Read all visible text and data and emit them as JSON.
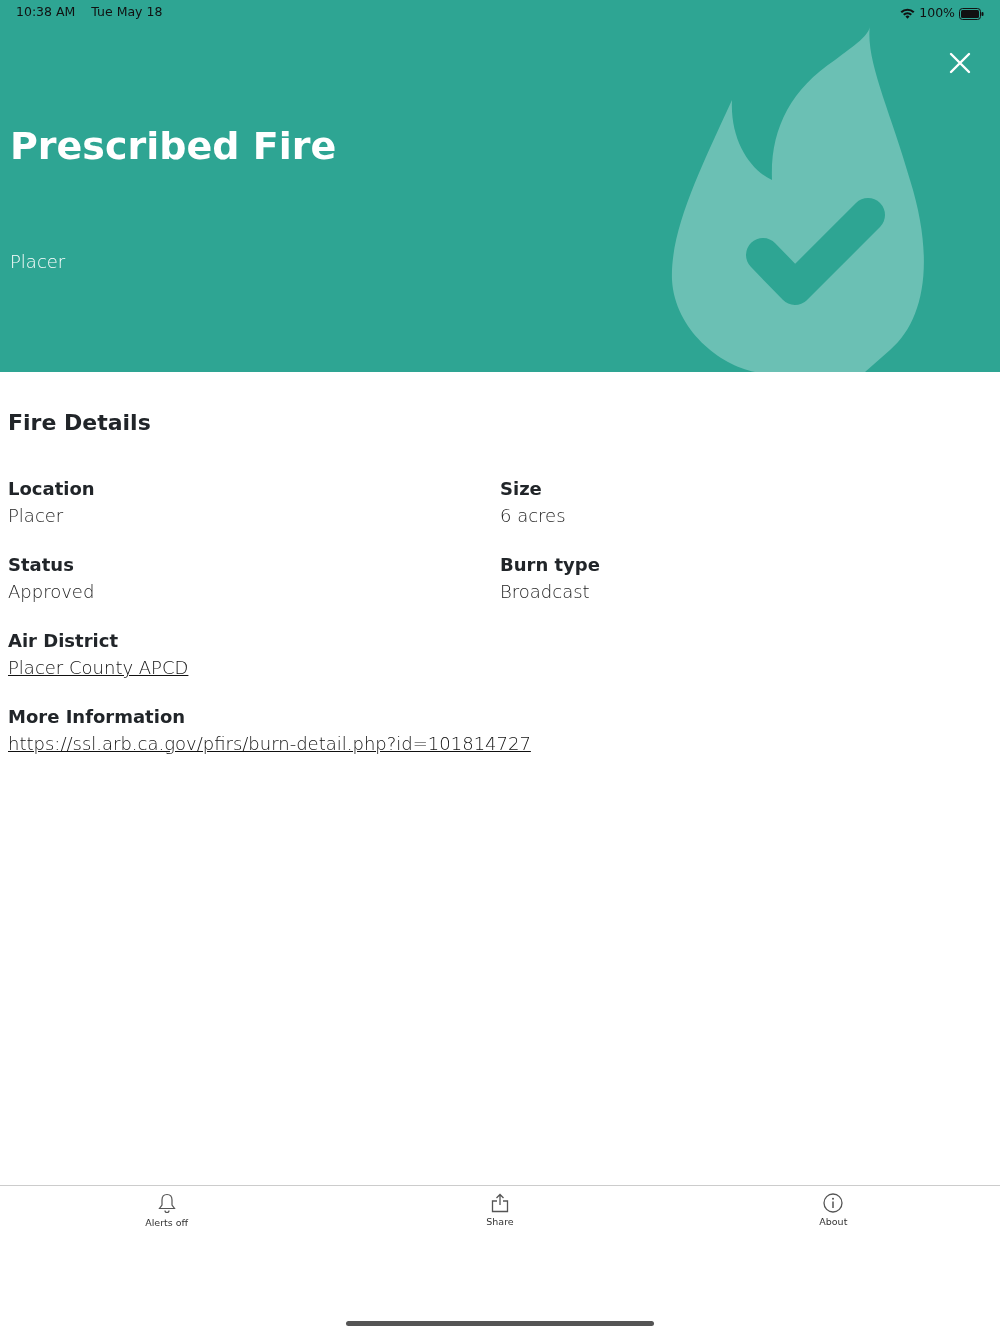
{
  "status_bar": {
    "time": "10:38 AM",
    "date": "Tue May 18",
    "battery": "100%"
  },
  "header": {
    "title": "Prescribed Fire",
    "subtitle": "Placer"
  },
  "section_title": "Fire Details",
  "fields": [
    {
      "label": "Location",
      "value": "Placer",
      "kind": "text"
    },
    {
      "label": "Size",
      "value": "6 acres",
      "kind": "text"
    },
    {
      "label": "Status",
      "value": "Approved",
      "kind": "text"
    },
    {
      "label": "Burn type",
      "value": "Broadcast",
      "kind": "text"
    },
    {
      "label": "Air District",
      "value": "Placer County APCD",
      "kind": "link"
    },
    {
      "label": "More Information",
      "value": "https://ssl.arb.ca.gov/pfirs/burn-detail.php?id=101814727",
      "kind": "link"
    }
  ],
  "tab_bar": [
    {
      "label": "Alerts off",
      "kind": "bell"
    },
    {
      "label": "Share",
      "kind": "share"
    },
    {
      "label": "About",
      "kind": "info"
    }
  ]
}
